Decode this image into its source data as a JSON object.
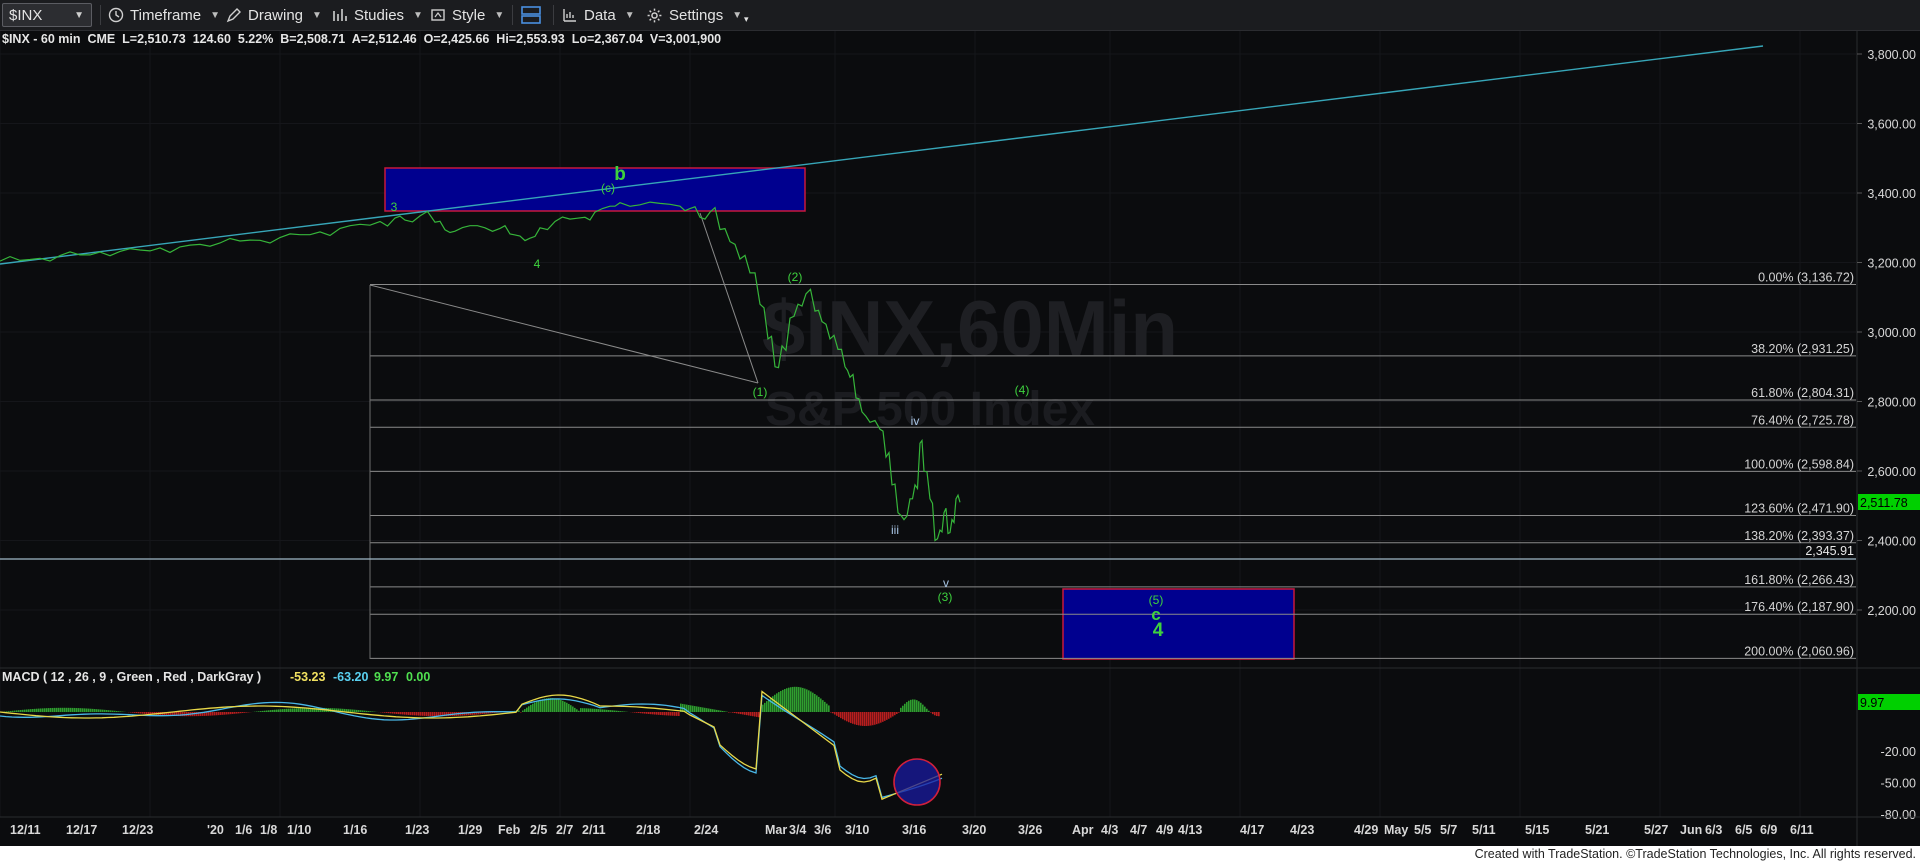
{
  "toolbar": {
    "symbol": "$INX",
    "timeframe": "Timeframe",
    "drawing": "Drawing",
    "studies": "Studies",
    "style": "Style",
    "data": "Data",
    "settings": "Settings"
  },
  "header": {
    "symbol_info": "$INX - 60 min  CME  L=2,510.73  124.60  5.22%  B=2,508.71  A=2,512.46  O=2,425.66  Hi=2,553.93  Lo=2,367.04  V=3,001,900",
    "watermark_1": "$INX,60Min",
    "watermark_2": "S&P 500 Index"
  },
  "price_axis": {
    "labels": [
      "3,800.00",
      "3,600.00",
      "3,400.00",
      "3,200.00",
      "3,000.00",
      "2,800.00",
      "2,600.00",
      "2,400.00",
      "2,200.00"
    ],
    "last_price": "2,511.78",
    "horizontal_line_price": "2,345.91",
    "colors": {
      "last_price_bg": "#00d000",
      "line_label_color": "#e8e8e8"
    }
  },
  "fib_levels": [
    {
      "label": "0.00% (3,136.72)",
      "price": 3136.72
    },
    {
      "label": "38.20% (2,931.25)",
      "price": 2931.25
    },
    {
      "label": "61.80% (2,804.31)",
      "price": 2804.31
    },
    {
      "label": "76.40% (2,725.78)",
      "price": 2725.78
    },
    {
      "label": "100.00% (2,598.84)",
      "price": 2598.84
    },
    {
      "label": "123.60% (2,471.90)",
      "price": 2471.9
    },
    {
      "label": "138.20% (2,393.37)",
      "price": 2393.37
    },
    {
      "label": "161.80% (2,266.43)",
      "price": 2266.43
    },
    {
      "label": "176.40% (2,187.90)",
      "price": 2187.9
    },
    {
      "label": "200.00% (2,060.96)",
      "price": 2060.96
    }
  ],
  "wave_labels": {
    "b": "b",
    "c_paren": "(c)",
    "three": "3",
    "four_small": "4",
    "w1": "(1)",
    "w2": "(2)",
    "w3": "(3)",
    "w4": "(4)",
    "w5": "(5)",
    "iii": "iii",
    "iv": "iv",
    "v": "v",
    "c_big": "c",
    "four_big": "4"
  },
  "macd": {
    "title": "MACD ( 12 , 26 , 9 , Green , Red , DarkGray )",
    "v1": "-53.23",
    "v2": "-63.20",
    "v3": "9.97",
    "v4": "0.00",
    "axis_labels": [
      "-20.00",
      "-50.00",
      "-80.00"
    ],
    "last_value": "9.97"
  },
  "time_axis": {
    "labels": [
      "12/11",
      "12/17",
      "12/23",
      "'20",
      "1/6",
      "1/8",
      "1/10",
      "1/16",
      "1/23",
      "1/29",
      "Feb",
      "2/5",
      "2/7",
      "2/11",
      "2/18",
      "2/24",
      "Mar",
      "3/4",
      "3/6",
      "3/10",
      "3/16",
      "3/20",
      "3/26",
      "Apr",
      "4/3",
      "4/7",
      "4/9",
      "4/13",
      "4/17",
      "4/23",
      "4/29",
      "May",
      "5/5",
      "5/7",
      "5/11",
      "5/15",
      "5/21",
      "5/27",
      "Jun",
      "6/3",
      "6/5",
      "6/9",
      "6/11"
    ]
  },
  "footer": {
    "credit": "Created with TradeStation. ©TradeStation Technologies, Inc. All rights reserved."
  }
}
